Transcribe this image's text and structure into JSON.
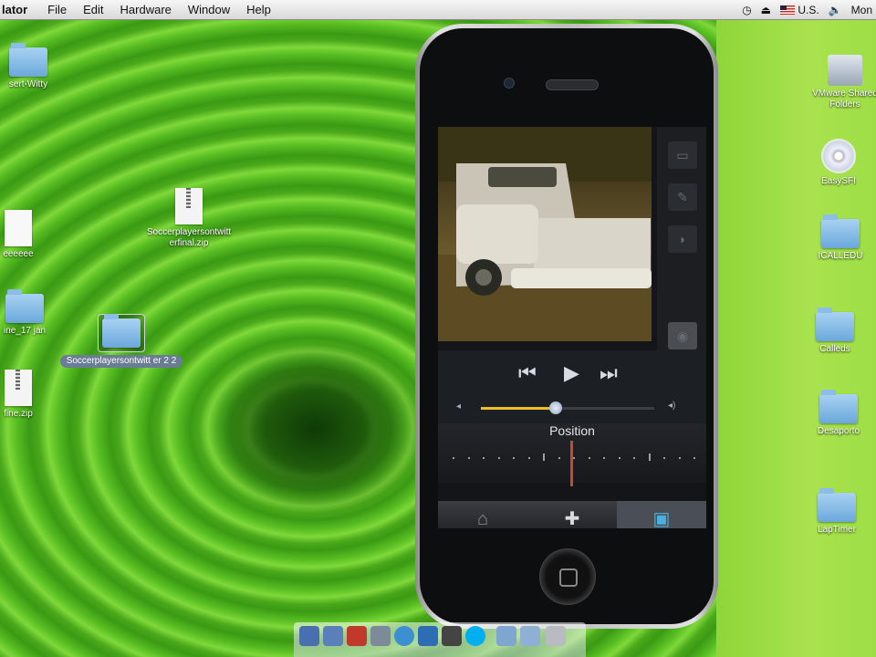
{
  "menubar": {
    "app_name": "lator",
    "menus": [
      "File",
      "Edit",
      "Hardware",
      "Window",
      "Help"
    ],
    "locale": "U.S.",
    "clock": "Mon"
  },
  "desktop_icons": {
    "left": [
      {
        "label": "sert-Witty",
        "kind": "folder"
      },
      {
        "label": "eeeeee",
        "kind": "doc"
      },
      {
        "label": "ine_17 jan",
        "kind": "folder"
      },
      {
        "label": "fine.zip",
        "kind": "zip"
      }
    ],
    "middle": [
      {
        "label": "Soccerplayersontwitt erfinal.zip",
        "kind": "zip"
      },
      {
        "label": "Soccerplayersontwitt er 2 2",
        "kind": "folder",
        "selected": true
      }
    ],
    "right": [
      {
        "label": "VMware Shared Folders",
        "kind": "hdd"
      },
      {
        "label": "EasySFI",
        "kind": "cd"
      },
      {
        "label": "ICALLEDU",
        "kind": "folder"
      },
      {
        "label": "Calleds",
        "kind": "folder"
      },
      {
        "label": "Desaporto",
        "kind": "folder"
      },
      {
        "label": "LapTimer",
        "kind": "folder"
      }
    ]
  },
  "player": {
    "scrubber_title": "Position",
    "volume_level": 0.43,
    "position_level": 0.5,
    "controls": {
      "prev": "⏮",
      "play": "▶",
      "next": "⏭"
    },
    "tabs": [
      {
        "icon": "home-icon",
        "glyph": "⌂"
      },
      {
        "icon": "add-icon",
        "glyph": "✚"
      },
      {
        "icon": "player-icon",
        "glyph": "▣",
        "active": true
      }
    ]
  }
}
